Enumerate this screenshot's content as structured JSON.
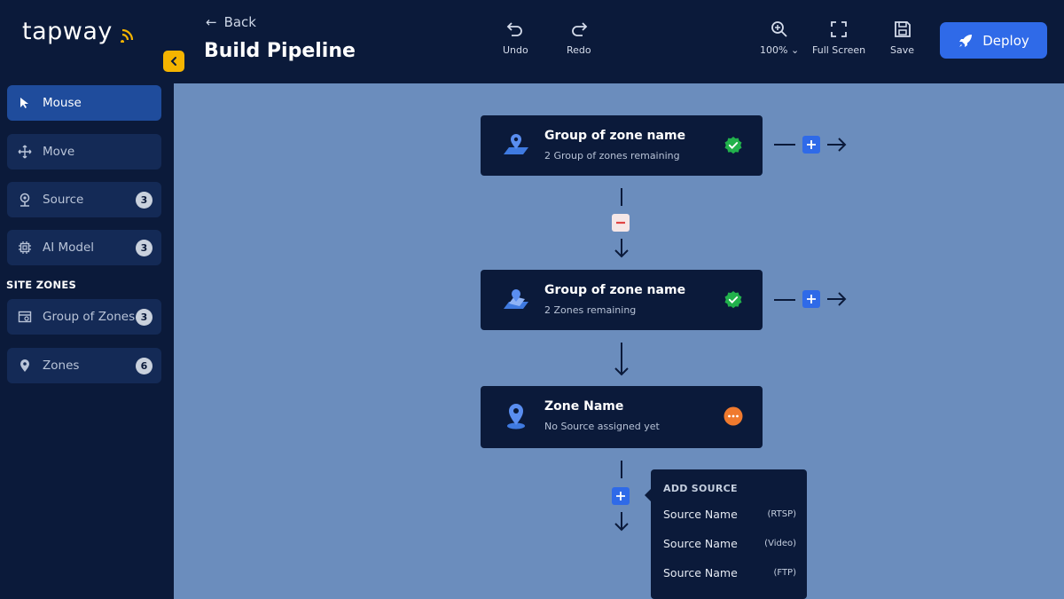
{
  "app": {
    "logo": "tapway"
  },
  "header": {
    "back_label": "Back",
    "title": "Build Pipeline",
    "tools": {
      "undo": "Undo",
      "redo": "Redo",
      "zoom": "100% ⌄",
      "fullscreen": "Full Screen",
      "save": "Save"
    },
    "deploy_label": "Deploy"
  },
  "sidebar": {
    "items": [
      {
        "label": "Mouse",
        "icon": "cursor-icon",
        "count": ""
      },
      {
        "label": "Move",
        "icon": "move-icon",
        "count": ""
      },
      {
        "label": "Source",
        "icon": "camera-icon",
        "count": "3"
      },
      {
        "label": "AI Model",
        "icon": "chip-icon",
        "count": "3"
      }
    ],
    "section_label": "SITE ZONES",
    "zone_items": [
      {
        "label": "Group of Zones",
        "icon": "zone-group-icon",
        "count": "3"
      },
      {
        "label": "Zones",
        "icon": "pin-icon",
        "count": "6"
      }
    ]
  },
  "nodes": [
    {
      "title": "Group of zone name",
      "subtitle": "2 Group of zones remaining",
      "status": "complete"
    },
    {
      "title": "Group of zone name",
      "subtitle": "2 Zones remaining",
      "status": "complete"
    },
    {
      "title": "Zone Name",
      "subtitle": "No Source assigned yet",
      "status": "pending"
    }
  ],
  "add_source": {
    "title": "ADD SOURCE",
    "options": [
      {
        "name": "Source Name",
        "type": "(RTSP)"
      },
      {
        "name": "Source Name",
        "type": "(Video)"
      },
      {
        "name": "Source Name",
        "type": "(FTP)"
      }
    ]
  },
  "colors": {
    "navy": "#0b1a3a",
    "canvas": "#6b8dbd",
    "accent_blue": "#2f6ae8",
    "active_item": "#1f4c9c",
    "success": "#22b14c",
    "pending": "#f07a2e",
    "collapse": "#f5b400"
  }
}
